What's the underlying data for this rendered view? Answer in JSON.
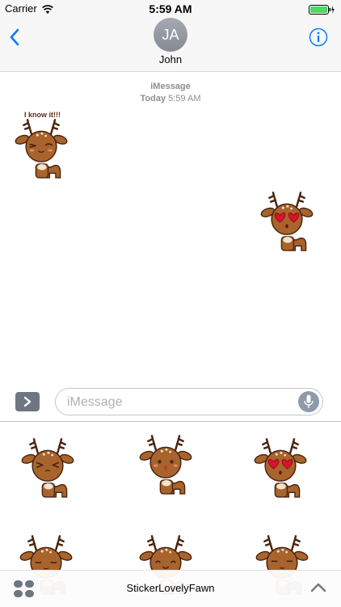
{
  "status_bar": {
    "carrier": "Carrier",
    "time": "5:59 AM"
  },
  "header": {
    "avatar_initials": "JA",
    "contact_name": "John"
  },
  "thread": {
    "service_label": "iMessage",
    "timestamp_day": "Today",
    "timestamp_time": "5:59 AM",
    "messages": [
      {
        "sender": "John",
        "type": "sticker",
        "caption": "I know it!!!",
        "expression": "wink"
      },
      {
        "sender": "me",
        "type": "sticker",
        "caption": "",
        "expression": "heart-eyes"
      }
    ]
  },
  "composer": {
    "placeholder": "iMessage"
  },
  "drawer": {
    "pack_name": "StickerLovelyFawn",
    "stickers": [
      {
        "expression": "squint"
      },
      {
        "expression": "surprised"
      },
      {
        "expression": "heart-eyes"
      },
      {
        "expression": "closed-eyes"
      },
      {
        "expression": "happy"
      },
      {
        "expression": "annoyed"
      }
    ]
  },
  "colors": {
    "accent": "#0a7aff",
    "fawn_fur": "#a8642c",
    "fawn_outline": "#4a2510",
    "heart": "#d9132a"
  }
}
